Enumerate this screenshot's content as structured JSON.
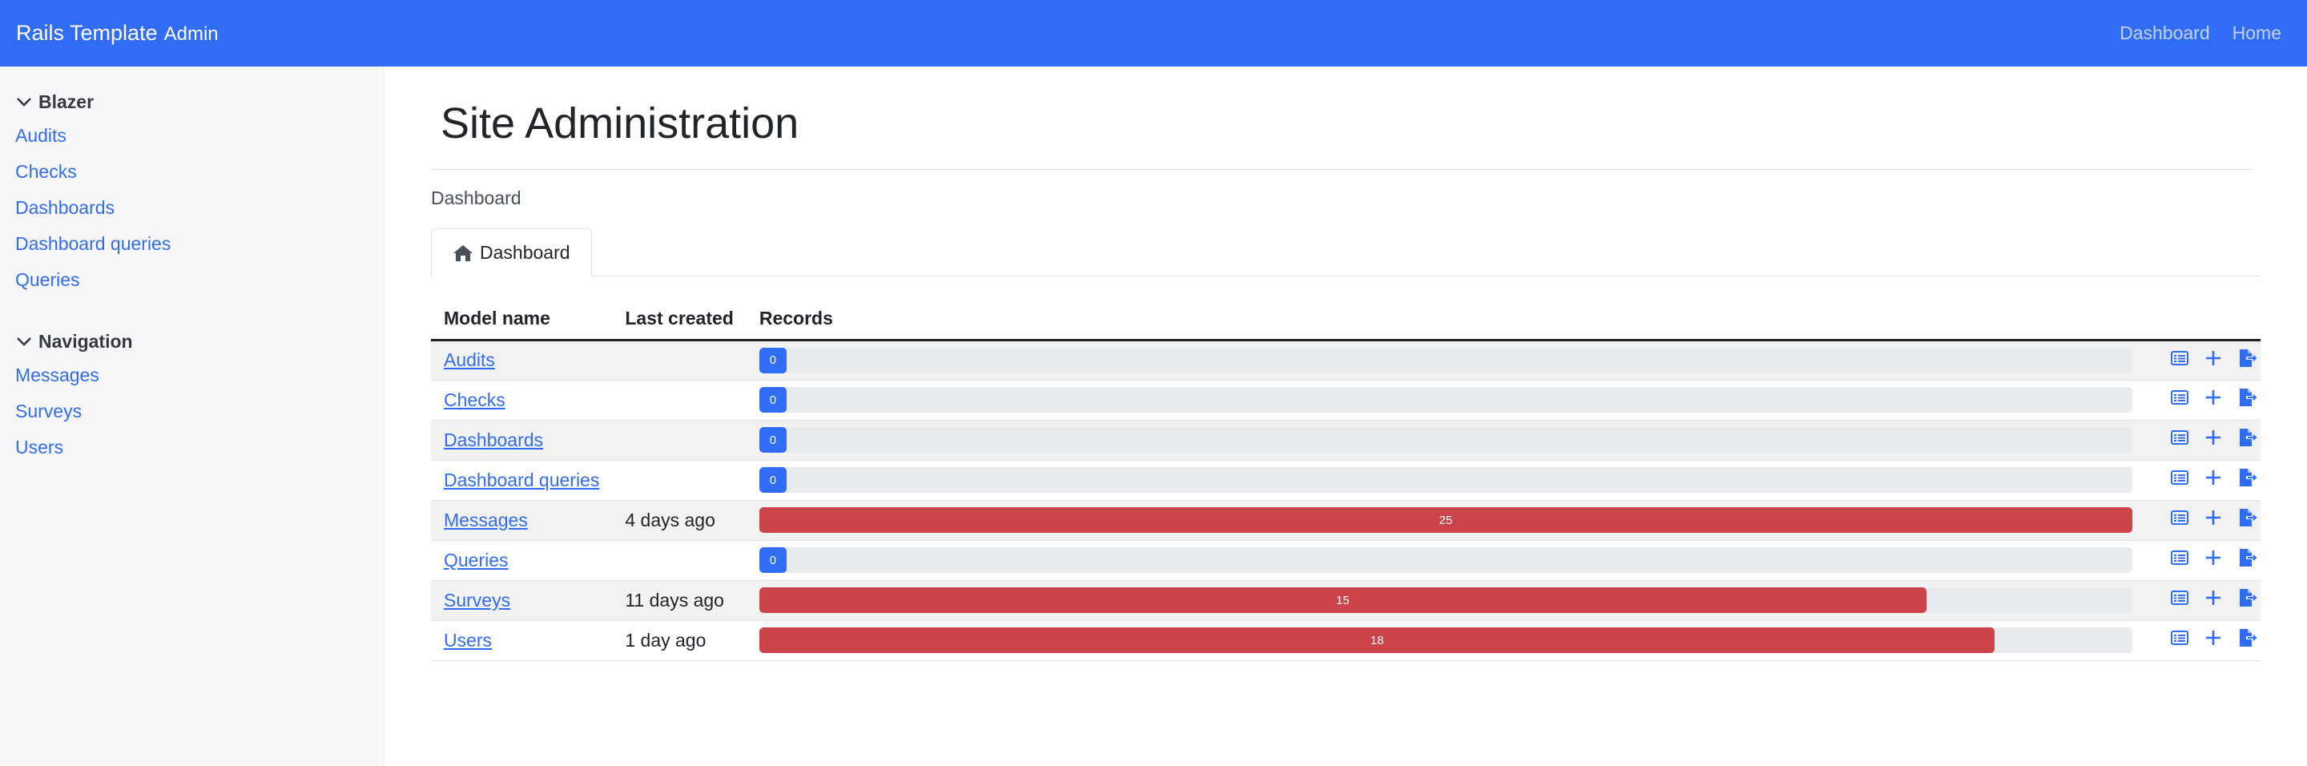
{
  "navbar": {
    "brand": "Rails Template",
    "brand_sub": "Admin",
    "links": [
      "Dashboard",
      "Home"
    ]
  },
  "sidebar": {
    "sections": [
      {
        "title": "Blazer",
        "items": [
          "Audits",
          "Checks",
          "Dashboards",
          "Dashboard queries",
          "Queries"
        ]
      },
      {
        "title": "Navigation",
        "items": [
          "Messages",
          "Surveys",
          "Users"
        ]
      }
    ]
  },
  "main": {
    "title": "Site Administration",
    "breadcrumb": "Dashboard",
    "tab_label": "Dashboard",
    "table": {
      "headers": [
        "Model name",
        "Last created",
        "Records"
      ],
      "rows": [
        {
          "model": "Audits",
          "last_created": "",
          "records": 0,
          "fill": 0
        },
        {
          "model": "Checks",
          "last_created": "",
          "records": 0,
          "fill": 0
        },
        {
          "model": "Dashboards",
          "last_created": "",
          "records": 0,
          "fill": 0
        },
        {
          "model": "Dashboard queries",
          "last_created": "",
          "records": 0,
          "fill": 0
        },
        {
          "model": "Messages",
          "last_created": "4 days ago",
          "records": 25,
          "fill": 1.0
        },
        {
          "model": "Queries",
          "last_created": "",
          "records": 0,
          "fill": 0
        },
        {
          "model": "Surveys",
          "last_created": "11 days ago",
          "records": 15,
          "fill": 0.85
        },
        {
          "model": "Users",
          "last_created": "1 day ago",
          "records": 18,
          "fill": 0.9
        }
      ]
    },
    "row_action_icons": [
      "list-icon",
      "plus-icon",
      "export-icon"
    ]
  },
  "colors": {
    "primary": "#316cf4",
    "danger": "#cb444a",
    "track": "#e9ecef"
  }
}
